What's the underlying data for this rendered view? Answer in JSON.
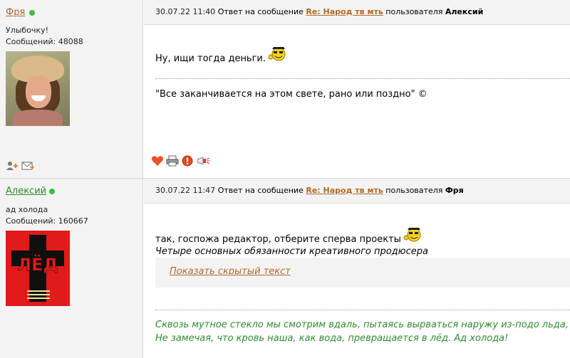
{
  "posts": [
    {
      "user": {
        "name": "Фря",
        "status": "Улыбочку!",
        "messages_label": "Сообщений: 48088"
      },
      "header": {
        "datetime": "30.07.22 11:40",
        "reply_prefix": "Ответ на сообщение",
        "reply_link": "Re: Народ тв мть",
        "user_prefix": "пользователя",
        "reply_user": "Алексий"
      },
      "body": {
        "text": "Ну, ищи тогда деньги.",
        "signature": "\"Все заканчивается на этом свете, рано или поздно\" ©"
      },
      "sidebar_icons": [
        "add-friend-icon",
        "mail-icon"
      ],
      "action_icons": [
        "heart-icon",
        "print-icon",
        "report-icon",
        "megaphone-icon"
      ]
    },
    {
      "user": {
        "name": "Алексий",
        "status": "ад холода",
        "messages_label": "Сообщений: 160667"
      },
      "header": {
        "datetime": "30.07.22 11:47",
        "reply_prefix": "Ответ на сообщение",
        "reply_link": "Re: Народ тв мть",
        "user_prefix": "пользователя",
        "reply_user": "Фря"
      },
      "body": {
        "text": "так, госпожа редактор, отберите сперва проекты",
        "italic_line": "Четыре основных обязанности креативного продюсера",
        "hidden_link": "Показать скрытый текст",
        "signature_line1": "Сквозь мутное стекло мы смотрим вдаль, пытаясь вырваться наружу из-подо льда,",
        "signature_line2": "Не замечая, что кровь наша, как вода, превращается в лёд. Ад холода!"
      }
    }
  ],
  "colors": {
    "link_brown": "#b06a2a",
    "link_green": "#2f8a2f",
    "online_green": "#3bbf3b",
    "panel_gray": "#f3f3f3"
  }
}
